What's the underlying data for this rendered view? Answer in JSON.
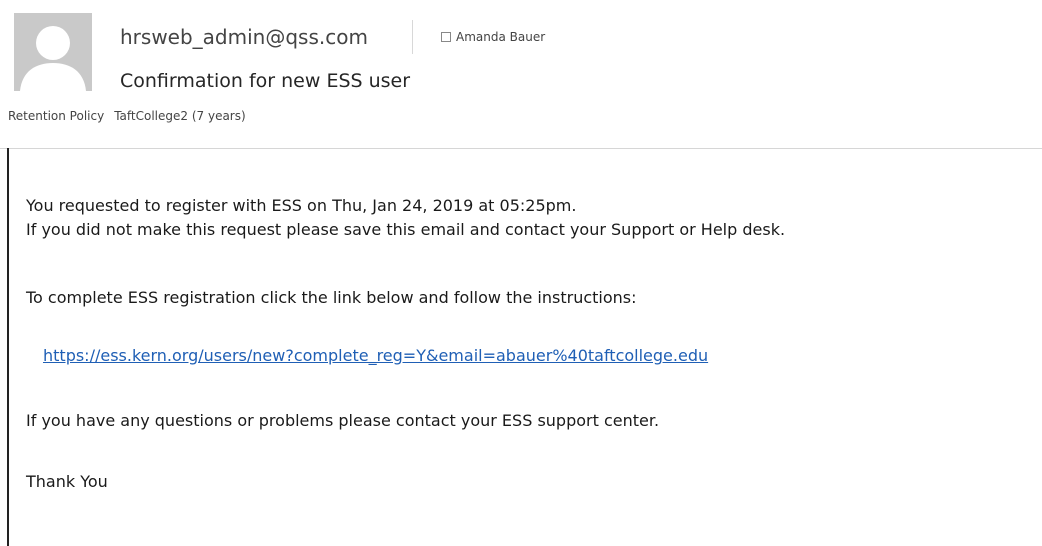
{
  "header": {
    "sender_email": "hrsweb_admin@qss.com",
    "recipient_name": "Amanda Bauer",
    "subject": "Confirmation for new ESS user",
    "retention_label": "Retention Policy",
    "retention_value": "TaftCollege2 (7 years)"
  },
  "body": {
    "line1": "You requested to register with ESS on Thu, Jan 24, 2019 at 05:25pm.",
    "line2": "If you did not make this request please save this email and contact your Support or Help desk.",
    "line3": "To complete ESS registration click the link below and follow the instructions:",
    "link": "https://ess.kern.org/users/new?complete_reg=Y&email=abauer%40taftcollege.edu",
    "line4": "If you have any questions or problems please contact your ESS support center.",
    "signoff": "Thank You"
  },
  "colors": {
    "link": "#1f5fb5",
    "avatar_bg": "#c9c9c9"
  },
  "icons": {
    "avatar": "person-silhouette-icon",
    "recipient_status": "checkbox-icon"
  }
}
